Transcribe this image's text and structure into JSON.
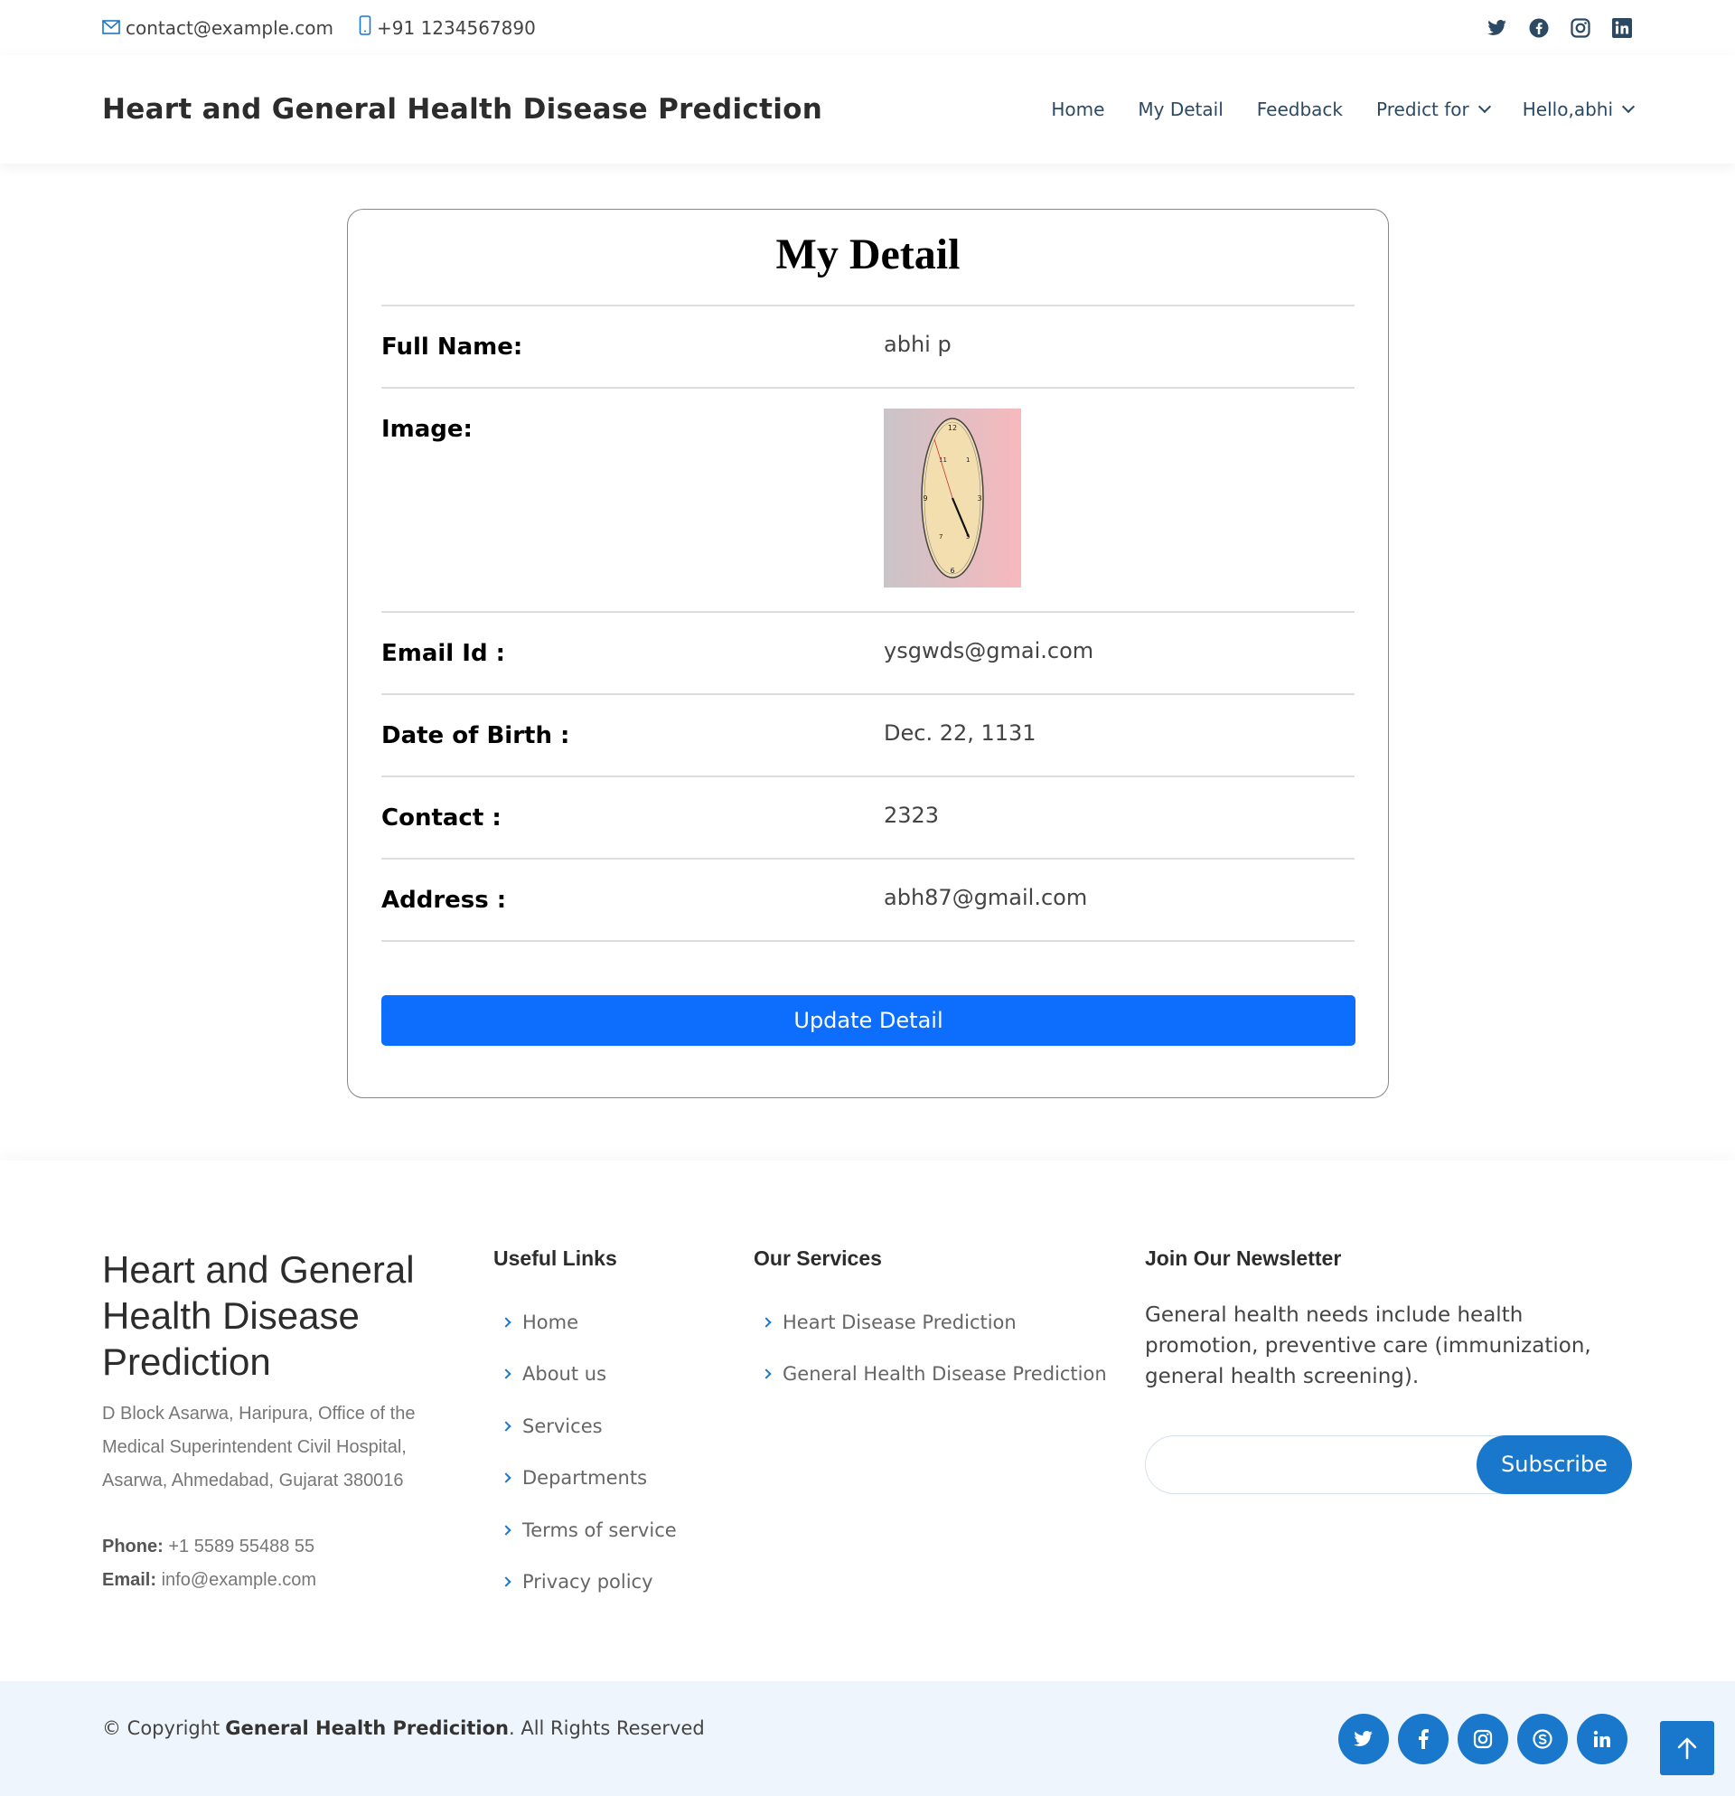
{
  "topbar": {
    "email": "contact@example.com",
    "phone": "+91 1234567890",
    "social_icons": [
      "twitter-icon",
      "facebook-icon",
      "instagram-icon",
      "linkedin-icon"
    ]
  },
  "header": {
    "logo": "Heart and General Health Disease Prediction",
    "nav": {
      "home": "Home",
      "my_detail": "My Detail",
      "feedback": "Feedback",
      "predict_for": "Predict for",
      "user": "Hello,abhi"
    }
  },
  "card": {
    "title": "My Detail",
    "rows": [
      {
        "label": "Full Name:",
        "value": "abhi p"
      },
      {
        "label": "Image:",
        "value": ""
      },
      {
        "label": "Email Id :",
        "value": "ysgwds@gmai.com"
      },
      {
        "label": "Date of Birth :",
        "value": "Dec. 22, 1131"
      },
      {
        "label": "Contact :",
        "value": "2323"
      },
      {
        "label": "Address :",
        "value": "abh87@gmail.com"
      }
    ],
    "update_button": "Update Detail"
  },
  "footer": {
    "brand_title": "Heart and General Health Disease Prediction",
    "address_line1": "D Block Asarwa, Haripura, Office of the",
    "address_line2": "Medical Superintendent Civil Hospital,",
    "address_line3": "Asarwa, Ahmedabad, Gujarat 380016",
    "phone_label": "Phone:",
    "phone_value": "+1 5589 55488 55",
    "email_label": "Email:",
    "email_value": "info@example.com",
    "useful_links": {
      "title": "Useful Links",
      "items": [
        "Home",
        "About us",
        "Services",
        "Departments",
        "Terms of service",
        "Privacy policy"
      ]
    },
    "services": {
      "title": "Our Services",
      "items": [
        "Heart Disease Prediction",
        "General Health Disease Prediction"
      ]
    },
    "newsletter": {
      "title": "Join Our Newsletter",
      "text": "General health needs include health promotion, preventive care (immunization, general health screening).",
      "input_value": "",
      "button": "Subscribe"
    }
  },
  "bottom": {
    "copyright_prefix": "© Copyright",
    "copyright_brand": "General Health Predicition",
    "copyright_suffix": ". All Rights Reserved",
    "social_icons": [
      "twitter-icon",
      "facebook-icon",
      "instagram-icon",
      "skype-icon",
      "linkedin-icon"
    ]
  },
  "colors": {
    "primary": "#1977cc",
    "button": "#0d6efd",
    "nav_text": "#2c4964",
    "bottom_bg": "#eff5fc"
  }
}
